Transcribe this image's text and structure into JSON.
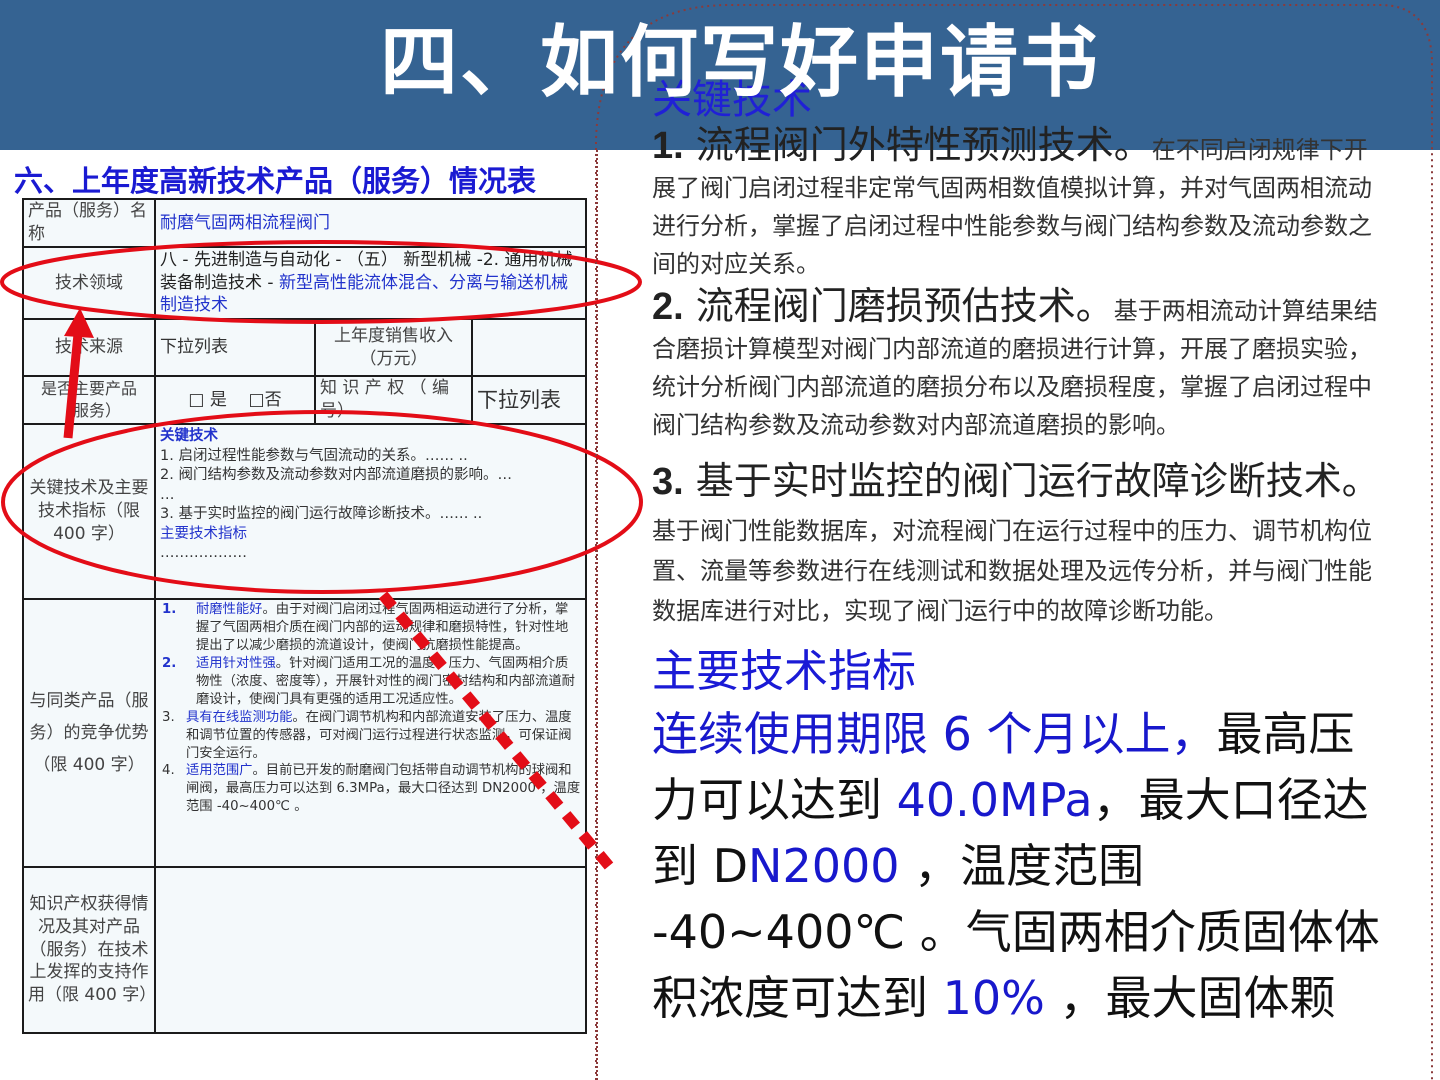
{
  "slide": {
    "title": "四、如何写好申请书",
    "header_color": "#356392",
    "accent_color": "#e30d17"
  },
  "table": {
    "title": "六、上年度高新技术产品（服务）情况表",
    "product_name_label": "产品（服务）名称",
    "product_name_value": "耐磨气固两相流程阀门",
    "tech_field_label": "技术领域",
    "tech_field_value_dark": "八 - 先进制造与自动化 - （五） 新型机械 -2. 通用机械装备制造技术 - ",
    "tech_field_value_blue": "新型高性能流体混合、分离与输送机械制造技术",
    "tech_source_label": "技术来源",
    "tech_source_value": "下拉列表",
    "sales_label": "上年度销售收入（万元）",
    "sales_value": "",
    "main_product_label": "是否主要产品（服务）",
    "main_product_yes": "□ 是",
    "main_product_no": "□否",
    "ip_label": "知 识 产 权 （ 编 号）",
    "ip_value": "下拉列表",
    "key_tech_label": "关键技术及主要技术指标（限 400 字）",
    "key_tech_heading": "关键技术",
    "key_tech_items": [
      "1. 启闭过程性能参数与气固流动的关系。…… ..",
      "2.  阀门结构参数及流动参数对内部流道磨损的影响。…",
      "…",
      "3.  基于实时监控的阀门运行故障诊断技术。…… .."
    ],
    "key_tech_indicator_heading": "主要技术指标",
    "key_tech_indicator_value": "………………",
    "advantage_label": "与同类产品（服务）的竞争优势（限 400 字）",
    "advantages": [
      {
        "num": "1.",
        "title": "耐磨性能好",
        "text": "。由于对阀门启闭过程气固两相运动进行了分析，掌握了气固两相介质在阀门内部的运动规律和磨损特性，针对性地提出了以减少磨损的流道设计，使阀门抗磨损性能提高。"
      },
      {
        "num": "2.",
        "title": "适用针对性强",
        "text": "。针对阀门适用工况的温度、压力、气固两相介质物性（浓度、密度等），开展针对性的阀门密封结构和内部流道耐磨设计，使阀门具有更强的适用工况适应性。"
      },
      {
        "num": "3.",
        "title": "具有在线监测功能",
        "text": "。在阀门调节机构和内部流道安装了压力、温度和调节位置的传感器，可对阀门运行过程进行状态监测，可保证阀门安全运行。"
      },
      {
        "num": "4.",
        "title": "适用范围广",
        "text": "。目前已开发的耐磨阀门包括带自动调节机构的球阀和闸阀，最高压力可以达到 6.3MPa，最大口径达到 DN2000 ，温度范围 -40~400℃ 。"
      }
    ],
    "ip_role_label": "知识产权获得情况及其对产品（服务）在技术上发挥的支持作用（限 400 字）",
    "ip_role_value": ""
  },
  "right_panel": {
    "heading": "关键技术",
    "items": [
      {
        "num": "1.",
        "title": " 流程阀门外特性预测技术。",
        "text": "在不同启闭规律下开展了阀门启闭过程非定常气固两相数值模拟计算，并对气固两相流动进行分析，掌握了启闭过程中性能参数与阀门结构参数及流动参数之间的对应关系。"
      },
      {
        "num": "2.",
        "title": "  流程阀门磨损预估技术。",
        "text": "基于两相流动计算结果结合磨损计算模型对阀门内部流道的磨损进行计算，开展了磨损实验，统计分析阀门内部流道的磨损分布以及磨损程度，掌握了启闭过程中阀门结构参数及流动参数对内部流道磨损的影响。"
      },
      {
        "num": "3.",
        "title": "  基于实时监控的阀门运行故障诊断技术。",
        "text": "基于阀门性能数据库，对流程阀门在运行过程中的压力、调节机构位置、流量等参数进行在线测试和数据处理及远传分析，并与阀门性能数据库进行对比，实现了阀门运行中的故障诊断功能。"
      }
    ],
    "indicator_heading": "主要技术指标",
    "spec_blue_1": "连续使用期限 6 个月以上，",
    "spec_dark_1": "最高压力可以达到 ",
    "spec_blue_2": "40.0MPa",
    "spec_dark_2": "，最大口径达到 D",
    "spec_blue_3": "N2000",
    "spec_dark_3": " ，温度范围 -40~400℃ 。气固两相介质固体体积浓度可达到 ",
    "spec_blue_4": "10%",
    "spec_dark_4": " ，最大固体颗"
  }
}
